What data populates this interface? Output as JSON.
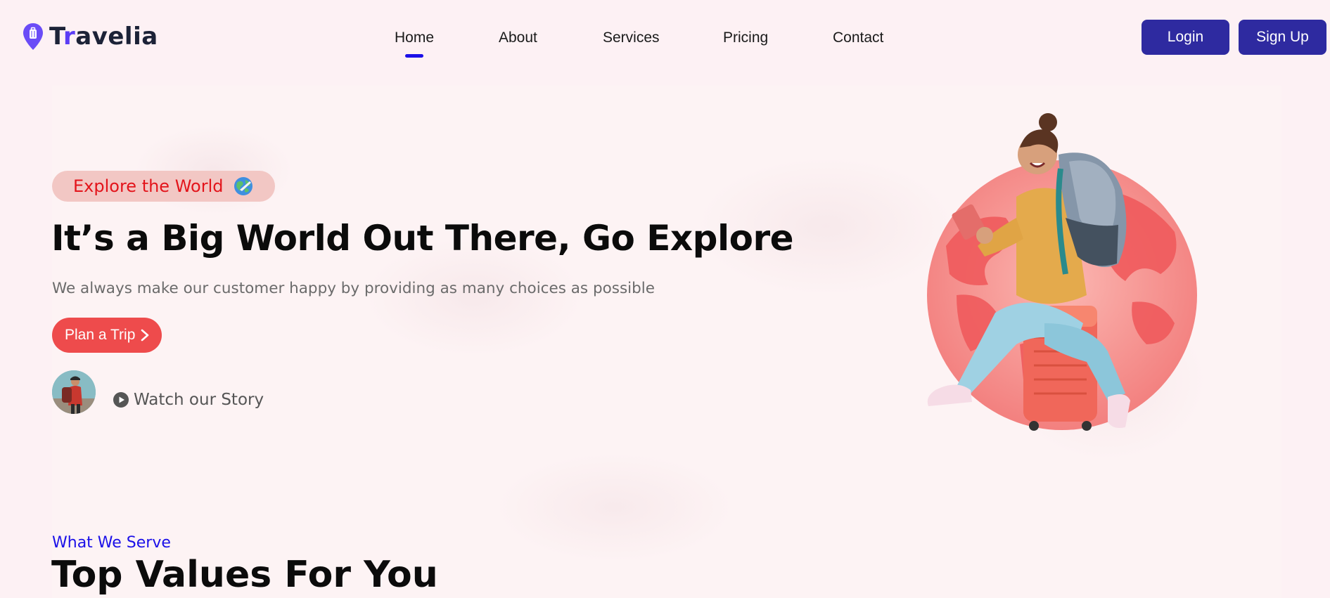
{
  "brand": {
    "name_first": "T",
    "name_accent": "r",
    "name_rest": "avelia",
    "accent_color": "#5b3df5"
  },
  "nav": {
    "items": [
      {
        "label": "Home",
        "active": true
      },
      {
        "label": "About",
        "active": false
      },
      {
        "label": "Services",
        "active": false
      },
      {
        "label": "Pricing",
        "active": false
      },
      {
        "label": "Contact",
        "active": false
      }
    ]
  },
  "auth": {
    "login_label": "Login",
    "signup_label": "Sign Up",
    "button_color": "#2e2aa0"
  },
  "hero": {
    "badge_text": "Explore the World",
    "badge_icon": "globe-airplane-icon",
    "title": "It’s a Big World Out There, Go Explore",
    "subtitle": "We always make our customer happy by providing as many choices as possible",
    "cta_label": "Plan a Trip",
    "cta_color": "#ee4b4c",
    "watch_label": "Watch our Story"
  },
  "section": {
    "kicker": "What We Serve",
    "title": "Top Values For You"
  }
}
